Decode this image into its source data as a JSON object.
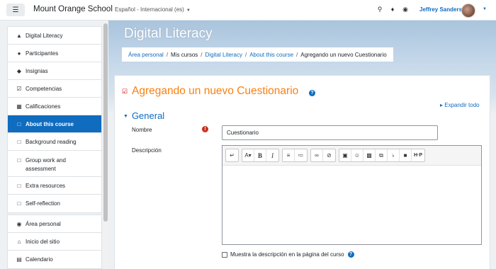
{
  "navbar": {
    "menu_icon": "hamburger-icon",
    "brand": "Mount Orange School",
    "language": "Español - Internacional (es)",
    "icons": [
      "search-icon",
      "bell-icon",
      "chat-icon"
    ],
    "user_name": "Jeffrey Sanders"
  },
  "sidebar": {
    "course_items": [
      {
        "icon": "graduation-cap-icon",
        "label": "Digital Literacy"
      },
      {
        "icon": "users-icon",
        "label": "Participantes"
      },
      {
        "icon": "badge-icon",
        "label": "Insignias"
      },
      {
        "icon": "checkbox-icon",
        "label": "Competencias"
      },
      {
        "icon": "table-icon",
        "label": "Calificaciones"
      },
      {
        "icon": "folder-icon",
        "label": "About this course",
        "active": true
      },
      {
        "icon": "folder-icon",
        "label": "Background reading"
      },
      {
        "icon": "folder-icon",
        "label": "Group work and assessment"
      },
      {
        "icon": "folder-icon",
        "label": "Extra resources"
      },
      {
        "icon": "folder-icon",
        "label": "Self-reflection"
      }
    ],
    "site_items": [
      {
        "icon": "dashboard-icon",
        "label": "Área personal"
      },
      {
        "icon": "home-icon",
        "label": "Inicio del sitio"
      },
      {
        "icon": "calendar-icon",
        "label": "Calendario"
      }
    ]
  },
  "header": {
    "course_title": "Digital Literacy",
    "breadcrumb": [
      "Área personal",
      "Mis cursos",
      "Digital Literacy",
      "About this course",
      "Agregando un nuevo Cuestionario"
    ]
  },
  "main": {
    "title": "Agregando un nuevo Cuestionario",
    "expand_all": "Expandir todo",
    "section": "General",
    "name_label": "Nombre",
    "name_value": "Cuestionario",
    "description_label": "Descripción",
    "show_description_label": "Muestra la descripción en la página del curso"
  },
  "colors": {
    "accent": "#0f6cbf",
    "title": "#f98012",
    "required": "#ca3120"
  }
}
